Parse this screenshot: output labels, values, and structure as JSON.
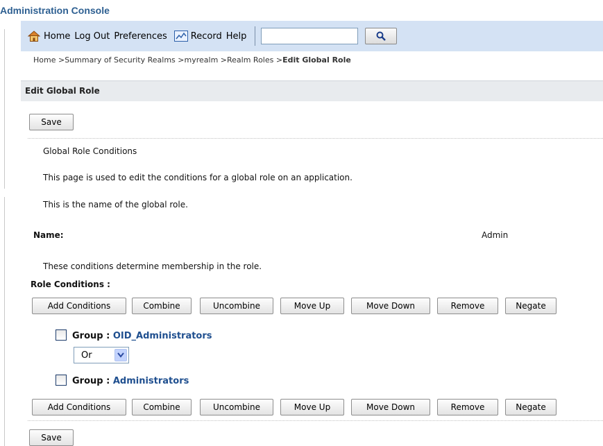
{
  "app": {
    "title": "Administration Console"
  },
  "toolbar": {
    "home": "Home",
    "logout": "Log Out",
    "preferences": "Preferences",
    "record": "Record",
    "help": "Help",
    "search_value": ""
  },
  "breadcrumb": {
    "items": [
      "Home >",
      "Summary of Security Realms >",
      "myrealm >",
      "Realm Roles >"
    ],
    "current": "Edit Global Role"
  },
  "section": {
    "title": "Edit Global Role"
  },
  "buttons": {
    "save": "Save"
  },
  "content": {
    "heading": "Global Role Conditions",
    "description": "This page is used to edit the conditions for a global role on an application.",
    "name_help": "This is the name of the global role.",
    "name_label": "Name:",
    "name_value": "Admin",
    "conditions_help": "These conditions determine membership in the role.",
    "conditions_label": "Role Conditions :"
  },
  "condition_buttons": [
    "Add Conditions",
    "Combine",
    "Uncombine",
    "Move Up",
    "Move Down",
    "Remove",
    "Negate"
  ],
  "conditions": [
    {
      "prefix": "Group : ",
      "name": "OID_Administrators",
      "checked": false
    },
    {
      "prefix": "Group : ",
      "name": "Administrators",
      "checked": false
    }
  ],
  "operator": {
    "selected": "Or"
  },
  "icons": {
    "home": "home-icon",
    "record": "record-icon",
    "search": "search-icon",
    "dropdown": "chevron-down-icon"
  }
}
